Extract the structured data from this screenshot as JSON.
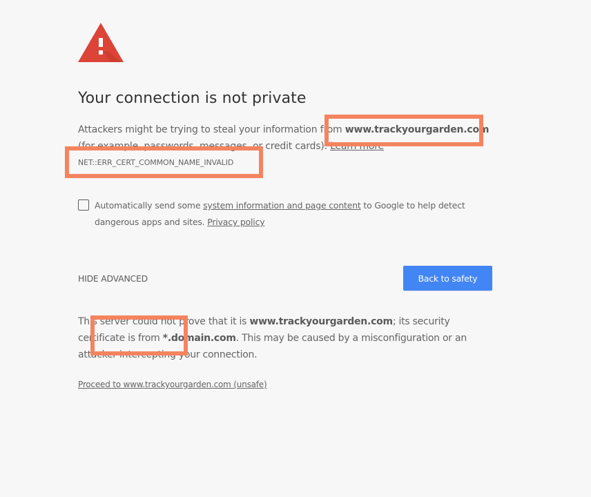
{
  "page": {
    "title": "Your connection is not private",
    "icon": "warning-triangle-icon"
  },
  "intro": {
    "text_before": "Attackers might be trying to steal your information from ",
    "domain": "www.trackyourgarden.com",
    "text_after": " (for example, passwords, messages, or credit cards). ",
    "learn_more": "Learn more"
  },
  "error_code": "NET::ERR_CERT_COMMON_NAME_INVALID",
  "reporting": {
    "checked": false,
    "text_before": "Automatically send some ",
    "link": "system information and page content",
    "text_after": " to Google to help detect dangerous apps and sites. ",
    "privacy_link": "Privacy policy"
  },
  "actions": {
    "hide_advanced": "HIDE ADVANCED",
    "back_to_safety": "Back to safety"
  },
  "details": {
    "text1": "This server could not prove that it is ",
    "domain": "www.trackyourgarden.com",
    "text2": "; its security certificate is from ",
    "cert_domain": "*.domain.com",
    "text3": ". This may be caused by a misconfiguration or an attacker intercepting your connection."
  },
  "proceed_link": "Proceed to www.trackyourgarden.com (unsafe)",
  "colors": {
    "background": "#f7f7f7",
    "warning_red": "#db4437",
    "button_blue": "#4285f4",
    "annotation": "#f4845f"
  }
}
